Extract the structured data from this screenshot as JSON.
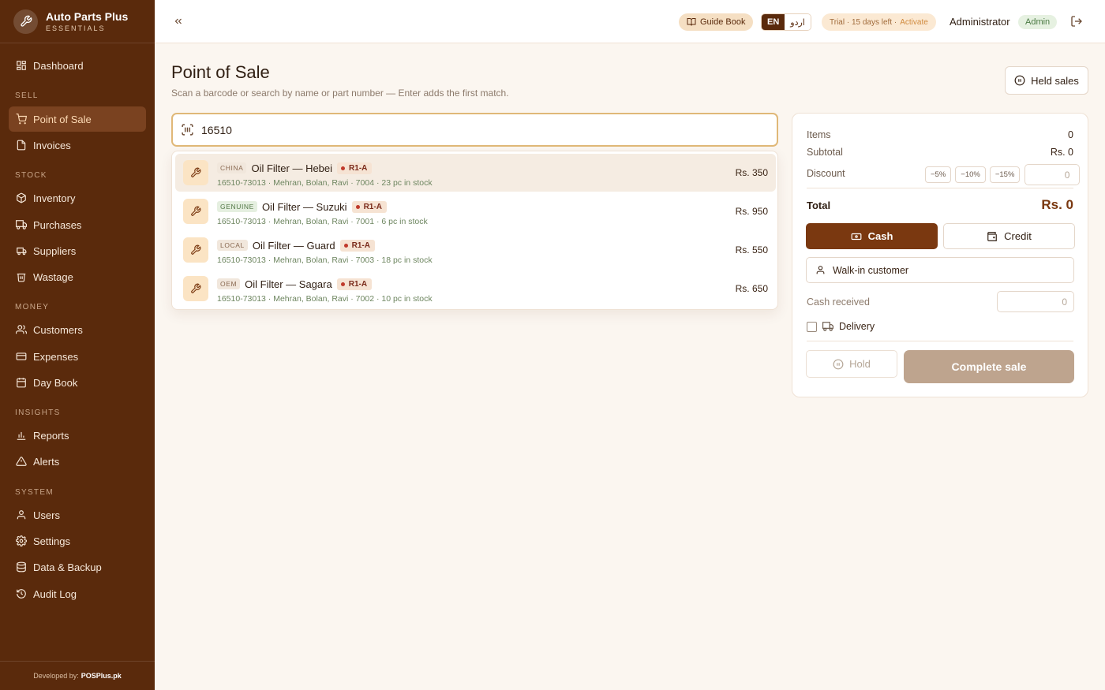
{
  "brand": {
    "name": "Auto Parts Plus",
    "subtitle": "ESSENTIALS"
  },
  "sidebar": {
    "items": [
      {
        "label": "Dashboard",
        "icon": "dashboard-icon"
      },
      {
        "label": "Point of Sale",
        "icon": "cart-icon",
        "active": true
      },
      {
        "label": "Invoices",
        "icon": "invoice-icon"
      },
      {
        "label": "Inventory",
        "icon": "box-icon"
      },
      {
        "label": "Purchases",
        "icon": "truck-icon"
      },
      {
        "label": "Suppliers",
        "icon": "supplier-icon"
      },
      {
        "label": "Wastage",
        "icon": "trash-icon"
      },
      {
        "label": "Customers",
        "icon": "users-icon"
      },
      {
        "label": "Expenses",
        "icon": "wallet-icon"
      },
      {
        "label": "Day Book",
        "icon": "calendar-icon"
      },
      {
        "label": "Reports",
        "icon": "bar-chart-icon"
      },
      {
        "label": "Alerts",
        "icon": "alert-icon"
      },
      {
        "label": "Users",
        "icon": "user-icon"
      },
      {
        "label": "Settings",
        "icon": "gear-icon"
      },
      {
        "label": "Data & Backup",
        "icon": "database-icon"
      },
      {
        "label": "Audit Log",
        "icon": "history-icon"
      }
    ],
    "sections": [
      "SELL",
      "STOCK",
      "MONEY",
      "INSIGHTS",
      "SYSTEM"
    ],
    "footer_prefix": "Developed by:",
    "footer_brand": "POSPlus.pk"
  },
  "topbar": {
    "guide_label": "Guide Book",
    "lang_en": "EN",
    "lang_ur": "اردو",
    "trial_text": "Trial · 15 days left ·",
    "trial_action": "Activate",
    "user_name": "Administrator",
    "role": "Admin"
  },
  "page": {
    "title": "Point of Sale",
    "subtitle": "Scan a barcode or search by name or part number — Enter adds the first match.",
    "held_sales_label": "Held sales"
  },
  "search": {
    "value": "16510"
  },
  "results": [
    {
      "tag": "CHINA",
      "name": "Oil Filter — Hebei",
      "location": "R1-A",
      "details": "16510-73013 · Mehran, Bolan, Ravi · 7004 · 23 pc in stock",
      "price": "Rs. 350"
    },
    {
      "tag": "GENUINE",
      "name": "Oil Filter — Suzuki",
      "location": "R1-A",
      "details": "16510-73013 · Mehran, Bolan, Ravi · 7001 · 6 pc in stock",
      "price": "Rs. 950"
    },
    {
      "tag": "LOCAL",
      "name": "Oil Filter — Guard",
      "location": "R1-A",
      "details": "16510-73013 · Mehran, Bolan, Ravi · 7003 · 18 pc in stock",
      "price": "Rs. 550"
    },
    {
      "tag": "OEM",
      "name": "Oil Filter — Sagara",
      "location": "R1-A",
      "details": "16510-73013 · Mehran, Bolan, Ravi · 7002 · 10 pc in stock",
      "price": "Rs. 650"
    }
  ],
  "cart": {
    "items_label": "Items",
    "items_value": "0",
    "subtotal_label": "Subtotal",
    "subtotal_value": "Rs. 0",
    "discount_label": "Discount",
    "discount_presets": [
      "−5%",
      "−10%",
      "−15%"
    ],
    "discount_placeholder": "0",
    "total_label": "Total",
    "total_value": "Rs. 0",
    "cash_label": "Cash",
    "credit_label": "Credit",
    "customer": "Walk-in customer",
    "cash_received_label": "Cash received",
    "cash_received_placeholder": "0",
    "delivery_label": "Delivery",
    "hold_label": "Hold",
    "complete_label": "Complete sale"
  },
  "colors": {
    "sidebar_bg": "#5a2a0c",
    "accent": "#7a3810",
    "page_bg": "#fbf6f0"
  }
}
